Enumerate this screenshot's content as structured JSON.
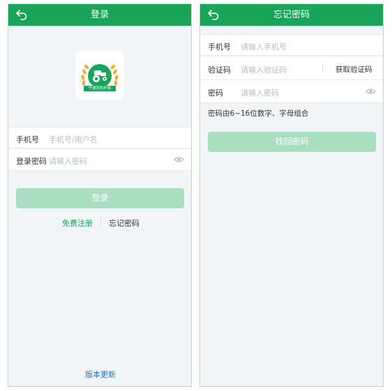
{
  "login": {
    "title": "登录",
    "logo_text": "宁波农机补贴",
    "phone_label": "手机号",
    "phone_placeholder": "手机号/用户名",
    "password_label": "登录密码",
    "password_placeholder": "请输入密码",
    "login_button": "登录",
    "register_link": "免费注册",
    "forgot_link": "忘记密码",
    "version_link": "版本更新"
  },
  "forgot": {
    "title": "忘记密码",
    "phone_label": "手机号",
    "phone_placeholder": "请输入手机号",
    "code_label": "验证码",
    "code_placeholder": "请输入验证码",
    "get_code_button": "获取验证码",
    "password_label": "密码",
    "password_placeholder": "请输入密码",
    "hint": "密码由6~16位数字、字母组合",
    "submit_button": "找回密码"
  },
  "colors": {
    "brand_green": "#19a457",
    "button_disabled": "#a9dfc0",
    "link_green": "#1aa35a",
    "version_blue": "#2f74b5"
  },
  "icons": {
    "back": "back-arrow-icon",
    "eye": "eye-icon",
    "logo": "tractor-wheat-logo-icon"
  }
}
